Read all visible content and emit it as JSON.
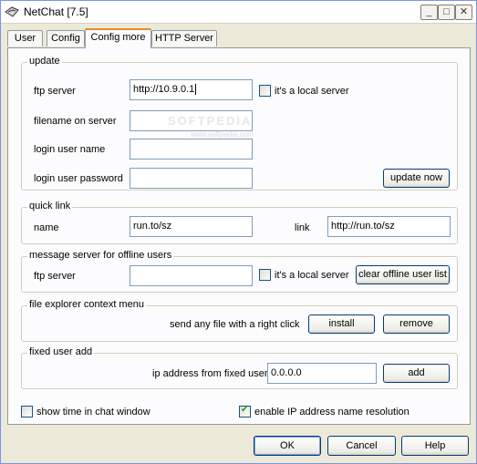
{
  "window": {
    "title": "NetChat [7.5]",
    "minimize_glyph": "_",
    "maximize_glyph": "□",
    "close_glyph": "✕"
  },
  "tabs": [
    {
      "label": "User"
    },
    {
      "label": "Config"
    },
    {
      "label": "Config more"
    },
    {
      "label": "HTTP Server"
    }
  ],
  "watermark": {
    "line1": "SOFTPEDIA",
    "line2": "www.softpedia.com"
  },
  "update": {
    "title": "update",
    "ftp_server_label": "ftp server",
    "ftp_server_value": "http://10.9.0.1",
    "local_server_label": "it's a local server",
    "filename_label": "filename on server",
    "filename_value": "",
    "login_user_label": "login user name",
    "login_user_value": "",
    "login_password_label": "login user password",
    "login_password_value": "",
    "update_button": "update now"
  },
  "quick_link": {
    "title": "quick link",
    "name_label": "name",
    "name_value": "run.to/sz",
    "link_label": "link",
    "link_value": "http://run.to/sz"
  },
  "message_server": {
    "title": "message server for offline users",
    "ftp_server_label": "ftp server",
    "ftp_server_value": "",
    "local_server_label": "it's a local server",
    "clear_button": "clear offline user list"
  },
  "file_explorer": {
    "title": "file explorer context menu",
    "description": "send any file with a right click",
    "install_button": "install",
    "remove_button": "remove"
  },
  "fixed_user": {
    "title": "fixed user add",
    "ip_label": "ip address from fixed user",
    "ip_value": "0.0.0.0",
    "add_button": "add"
  },
  "options": {
    "show_time_label": "show time in chat window",
    "show_time_checked": false,
    "resolve_ip_label": "enable IP address name resolution",
    "resolve_ip_checked": true
  },
  "footer": {
    "ok": "OK",
    "cancel": "Cancel",
    "help": "Help"
  }
}
